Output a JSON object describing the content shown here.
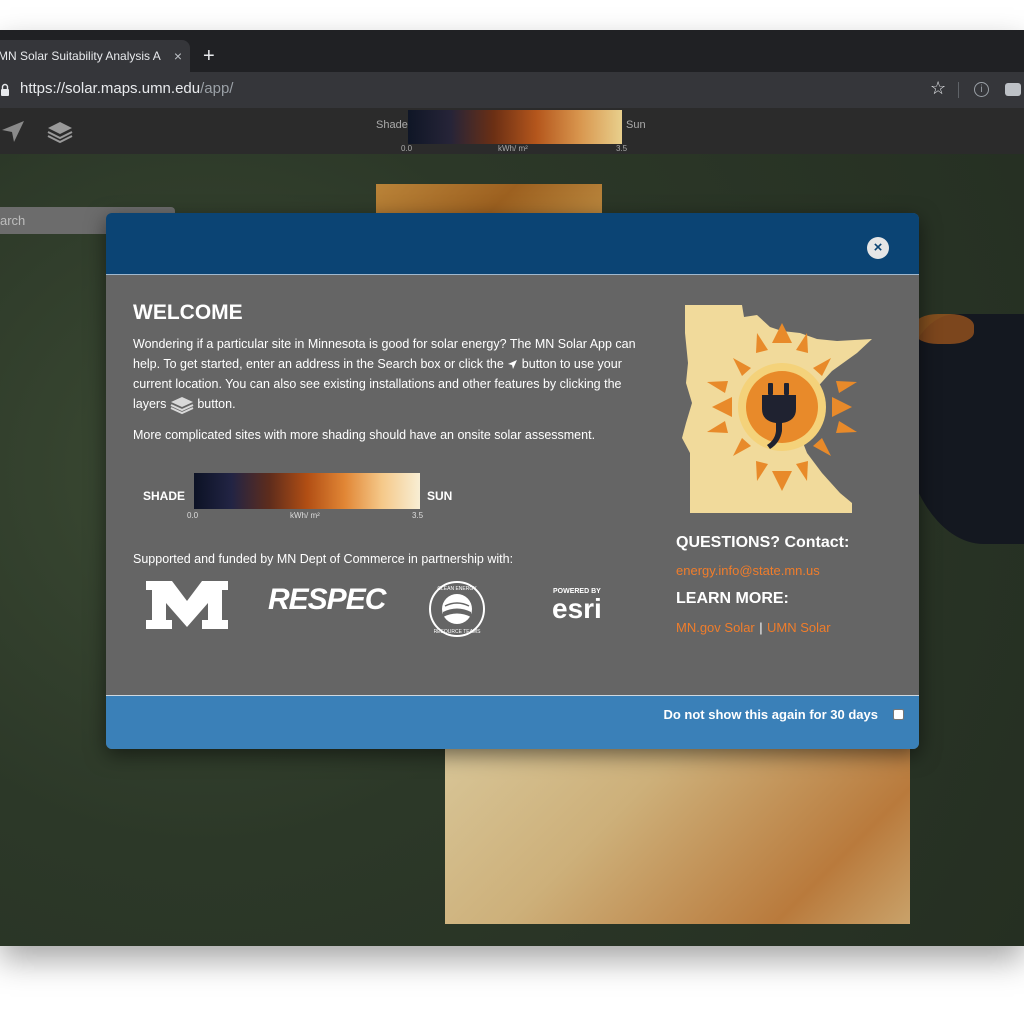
{
  "browser": {
    "tab_title": "MN Solar Suitability Analysis A",
    "tab_close": "×",
    "new_tab": "+",
    "url_host": "https://solar.maps.umn.edu",
    "url_path": "/app/",
    "bookmark_star": "☆",
    "info": "i"
  },
  "toolbar": {
    "legend": {
      "shade_label": "Shade",
      "sun_label": "Sun",
      "min": "0.0",
      "unit": "kWh/ m²",
      "max": "3.5"
    }
  },
  "search": {
    "placeholder": "Search",
    "visible_text": "arch"
  },
  "modal": {
    "close": "×",
    "title": "WELCOME",
    "intro_1": "Wondering if a particular site in Minnesota is good for solar energy? The MN Solar App can help. To get started, enter an address in the Search box or click the",
    "intro_2": "button to use your current location. You can also see existing installations and other features by clicking the layers",
    "intro_3": "button.",
    "note": "More complicated sites with more shading should have an onsite solar assessment.",
    "legend": {
      "shade": "SHADE",
      "sun": "SUN",
      "min": "0.0",
      "unit": "kWh/ m²",
      "max": "3.5"
    },
    "supported": "Supported and funded by MN Dept of Commerce in partnership with:",
    "logos": {
      "respec": "RESPEC",
      "cert_top": "CLEAN ENERGY",
      "cert_bottom": "RESOURCE TEAMS",
      "esri_powered": "POWERED BY",
      "esri": "esri"
    },
    "questions": "QUESTIONS? Contact:",
    "contact_email": "energy.info@state.mn.us",
    "learn_more": "LEARN MORE:",
    "link_mn": "MN.gov Solar",
    "link_sep": "|",
    "link_umn": "UMN Solar",
    "dont_show": "Do not show this again for 30 days",
    "dont_show_checked": false
  },
  "colors": {
    "modal_header": "#0b4474",
    "modal_footer": "#3a80b8",
    "link": "#f07d2b",
    "modal_body": "#656565"
  }
}
